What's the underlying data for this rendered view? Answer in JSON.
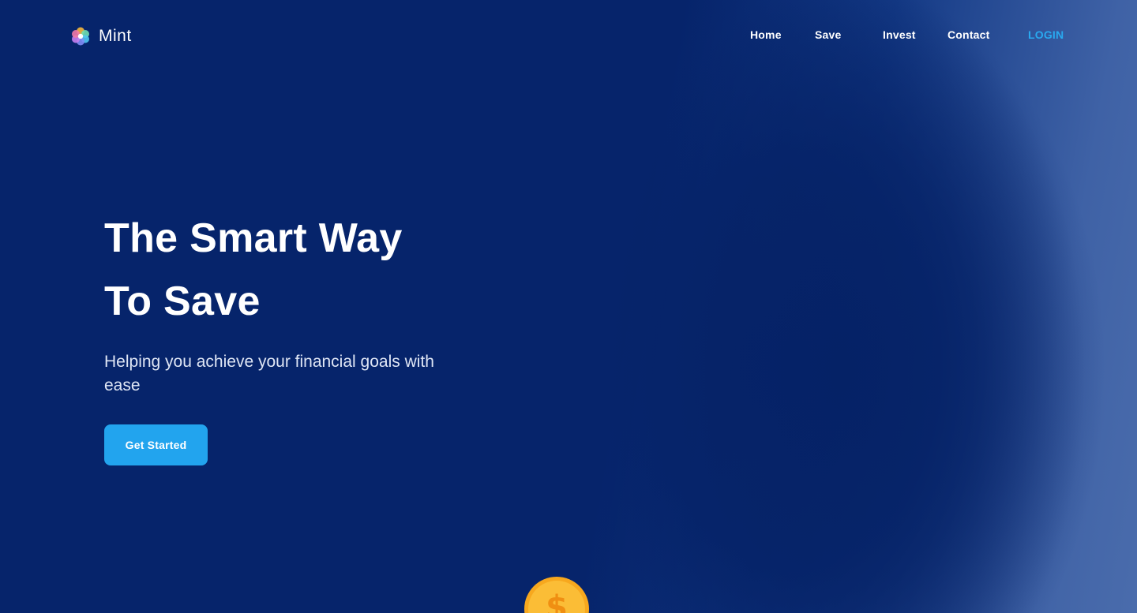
{
  "brand": {
    "name": "Mint",
    "logo_icon": "flower-logo-icon"
  },
  "nav": {
    "items": [
      {
        "label": "Home"
      },
      {
        "label": "Save"
      },
      {
        "label": "Invest"
      },
      {
        "label": "Contact"
      }
    ],
    "login_label": "LOGIN"
  },
  "hero": {
    "title_line1": "The Smart Way",
    "title_line2": "To Save",
    "subtitle": "Helping you achieve your financial goals with ease",
    "cta_label": "Get Started"
  },
  "decor": {
    "coin_icon": "dollar-coin-icon",
    "coin_symbol": "$"
  },
  "colors": {
    "background": "#06246b",
    "accent": "#22a4ee",
    "login": "#29a9f0",
    "coin": "#f9b52b"
  }
}
